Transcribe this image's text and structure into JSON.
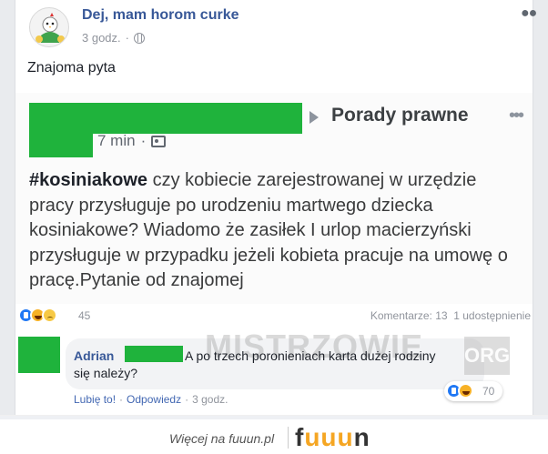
{
  "post": {
    "page_name": "Dej, mam horom curke",
    "time": "3 godz.",
    "time_separator": "·",
    "text": "Znajoma pyta"
  },
  "shared": {
    "group_name": "Porady prawne",
    "time": "7 min",
    "time_separator": "·",
    "hashtag": "#kosiniakowe",
    "question": " czy kobiecie zarejestrowanej w urzędzie pracy przysługuje  po urodzeniu martwego dziecka kosiniakowe? Wiadomo że zasiłek I urlop macierzyński przysługuje w przypadku jeżeli kobieta pracuje  na umowę o pracę.Pytanie od znajomej"
  },
  "stats": {
    "reaction_count": "45",
    "comments": "Komentarze: 13",
    "shares": "1 udostępnienie"
  },
  "comment": {
    "author": "Adrian",
    "text_line1": "A po trzech poronieniach karta dużej rodziny",
    "text_line2": "się należy?",
    "like_label": "Lubię to!",
    "reply_label": "Odpowiedz",
    "time": "3 godz.",
    "separator": "·",
    "reaction_count": "70"
  },
  "watermark": {
    "text": "MISTRZOWIE",
    "suffix": "ORG"
  },
  "footer": {
    "text": "Więcej na fuuun.pl",
    "logo_f": "f",
    "logo_uuu": "uuu",
    "logo_n": "n"
  },
  "colors": {
    "brand_blue": "#385898",
    "redaction_green": "#1fb33c",
    "like_blue": "#2078f4"
  }
}
